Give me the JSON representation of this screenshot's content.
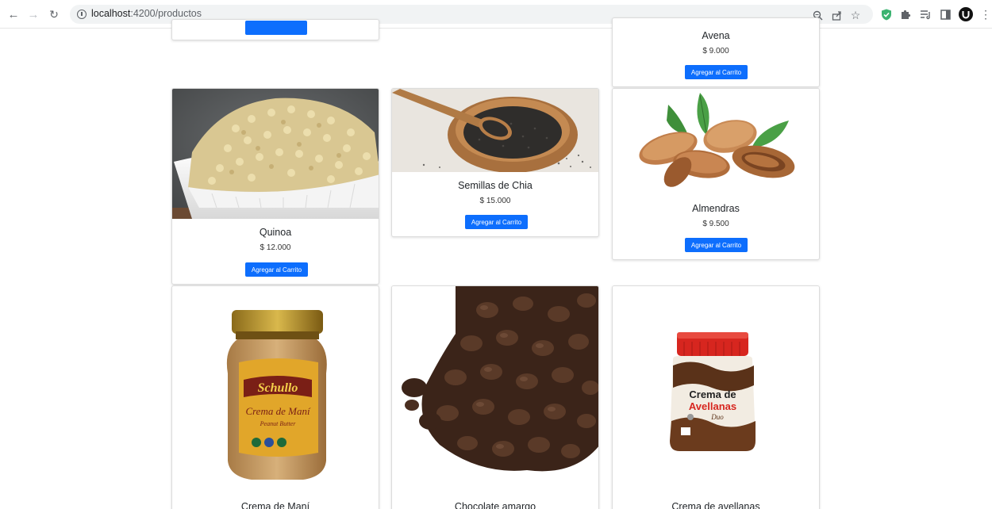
{
  "browser": {
    "url_host": "localhost",
    "url_path": ":4200/productos"
  },
  "products": [
    {
      "name": "",
      "price": "",
      "button": ""
    },
    {
      "name": "Avena",
      "price": "$ 9.000",
      "button": "Agregar al Carrito"
    },
    {
      "name": "Quinoa",
      "price": "$ 12.000",
      "button": "Agregar al Carrito"
    },
    {
      "name": "Semillas de Chia",
      "price": "$ 15.000",
      "button": "Agregar al Carrito"
    },
    {
      "name": "Almendras",
      "price": "$ 9.500",
      "button": "Agregar al Carrito"
    },
    {
      "name": "Crema de Maní",
      "price": "",
      "button": ""
    },
    {
      "name": "Chocolate amargo",
      "price": "",
      "button": ""
    },
    {
      "name": "Crema de avellanas",
      "price": "",
      "button": ""
    }
  ],
  "jar_labels": {
    "schullo_brand": "Schullo",
    "schullo_product": "Crema de Maní",
    "schullo_sub": "Peanut Butter",
    "avellanas_brand": "Crema de",
    "avellanas_product": "Avellanas",
    "avellanas_sub": "Duo"
  },
  "colors": {
    "primary": "#0d6efd",
    "card_border": "#dcdcdc"
  }
}
